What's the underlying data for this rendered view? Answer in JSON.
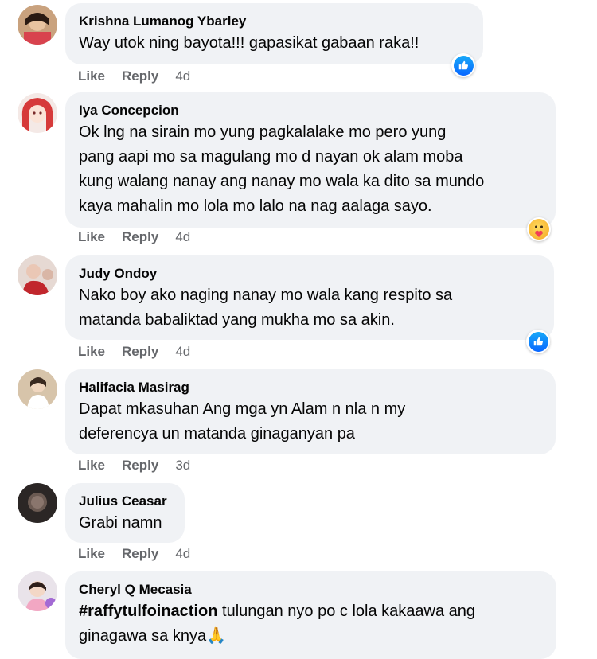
{
  "actions": {
    "like": "Like",
    "reply": "Reply"
  },
  "comments": [
    {
      "author": "Krishna Lumanog Ybarley",
      "lines": [
        "Way utok ning bayota!!! gapasikat gabaan raka!!"
      ],
      "time": "4d",
      "reaction": "like-icon"
    },
    {
      "author": "Iya Concepcion",
      "lines": [
        "Ok lng na sirain mo yung pagkalalake mo pero yung",
        "pang aapi mo sa magulang mo d nayan ok alam moba",
        "kung walang nanay ang nanay mo wala ka dito sa mundo",
        "kaya mahalin mo lola mo lalo na nag aalaga sayo."
      ],
      "time": "4d",
      "reaction": "care-icon"
    },
    {
      "author": "Judy Ondoy",
      "lines": [
        "Nako boy ako naging nanay mo wala kang respito sa",
        "matanda babaliktad yang mukha mo sa akin."
      ],
      "time": "4d",
      "reaction": "like-icon"
    },
    {
      "author": "Halifacia Masirag",
      "lines": [
        "Dapat mkasuhan Ang mga yn Alam n nla n my",
        "deferencya un matanda ginaganyan pa"
      ],
      "time": "3d",
      "reaction": ""
    },
    {
      "author": "Julius Ceasar",
      "lines": [
        "Grabi namn"
      ],
      "time": "4d",
      "reaction": ""
    },
    {
      "author": "Cheryl Q Mecasia",
      "hashtag": "#raffytulfoinaction",
      "lines": [
        " tulungan nyo po c lola kakaawa ang",
        "ginagawa sa knya🙏"
      ],
      "time": "",
      "reaction": ""
    }
  ]
}
